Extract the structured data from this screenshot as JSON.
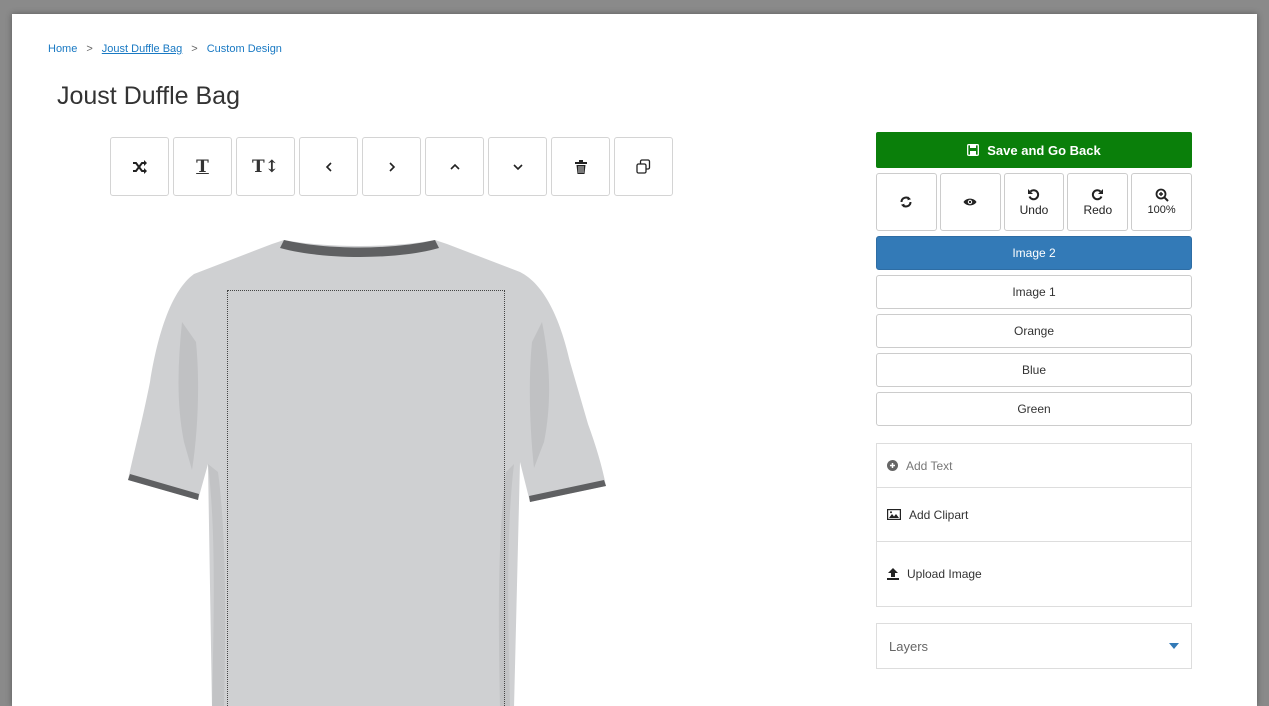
{
  "breadcrumb": {
    "home": "Home",
    "product": "Joust Duffle Bag",
    "current": "Custom Design",
    "separator": ">"
  },
  "page_title": "Joust Duffle Bag",
  "toolbar": {
    "text_icon_glyph": "T",
    "text_size_glyph": "T↕"
  },
  "panel": {
    "save_label": "Save and Go Back",
    "undo_label": "Undo",
    "redo_label": "Redo",
    "zoom_label": "100%",
    "options": [
      "Image 2",
      "Image 1",
      "Orange",
      "Blue",
      "Green"
    ],
    "active_option": "Image 2",
    "add_text": "Add Text",
    "add_clipart": "Add Clipart",
    "upload_image": "Upload Image",
    "layers": "Layers"
  },
  "colors": {
    "save": "#0a7f0a",
    "active": "#337ab7",
    "link": "#1979c3",
    "shirt": "#cfd0d2",
    "trim": "#5f6062"
  }
}
